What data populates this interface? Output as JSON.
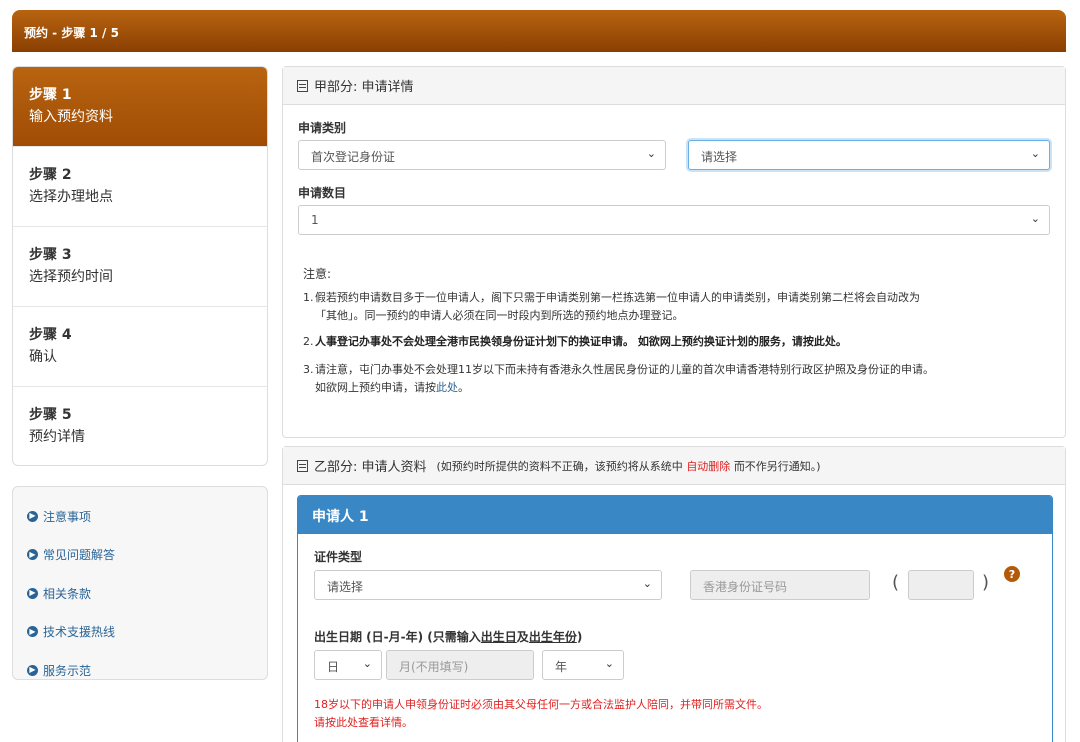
{
  "header": {
    "title": "预约 - 步骤 1 / 5"
  },
  "steps": [
    {
      "num": "步骤 1",
      "name": "输入预约资料"
    },
    {
      "num": "步骤 2",
      "name": "选择办理地点"
    },
    {
      "num": "步骤 3",
      "name": "选择预约时间"
    },
    {
      "num": "步骤 4",
      "name": "确认"
    },
    {
      "num": "步骤 5",
      "name": "预约详情"
    }
  ],
  "links": [
    {
      "label": "注意事项"
    },
    {
      "label": "常见问题解答"
    },
    {
      "label": "相关条款"
    },
    {
      "label": "技术支援热线"
    },
    {
      "label": "服务示范"
    }
  ],
  "part_a": {
    "title": "甲部分: 申请详情",
    "category_label": "申请类别",
    "category_value": "首次登记身份证",
    "category_value2": "请选择",
    "count_label": "申请数目",
    "count_value": "1",
    "notes_title": "注意:",
    "note1_num": "1.",
    "note1_line1": "假若预约申请数目多于一位申请人，阁下只需于申请类别第一栏拣选第一位申请人的申请类别，申请类别第二栏将会自动改为",
    "note1_line2": "「其他」。同一预约的申请人必须在同一时段内到所选的预约地点办理登记。",
    "note2_num": "2.",
    "note2_text": "人事登记办事处不会处理全港市民换领身份证计划下的换证申请。 如欲网上预约换证计划的服务，请按",
    "note2_link": "此处",
    "note2_end": "。",
    "note3_num": "3.",
    "note3_line1": "请注意，屯门办事处不会处理11岁以下而未持有香港永久性居民身份证的儿童的首次申请香港特别行政区护照及身份证的申请。",
    "note3_line2": "如欲网上预约申请，请按",
    "note3_link": "此处",
    "note3_end": "。"
  },
  "part_b": {
    "title": "乙部分: 申请人资料",
    "subtitle_pre": "(如预约时所提供的资料不正确，该预约将从系统中",
    "subtitle_red": "自动删除",
    "subtitle_post": "而不作另行通知。)",
    "applicant_title": "申请人 1",
    "doc_type_label": "证件类型",
    "doc_type_value": "请选择",
    "hkid_placeholder": "香港身份证号码",
    "paren_open": "(",
    "paren_close": ")",
    "help": "?",
    "dob_label_pre": "出生日期 (日-月-年) (只需输入",
    "dob_label_u1": "出生日",
    "dob_label_mid": "及",
    "dob_label_u2": "出生年份",
    "dob_label_post": ")",
    "day_value": "日",
    "month_placeholder": "月(不用填写)",
    "year_value": "年",
    "warn_line1": "18岁以下的申请人申领身份证时必须由其父母任何一方或合法监护人陪同，并带同所需文件。",
    "warn_line2": "请按此处查看详情。"
  }
}
